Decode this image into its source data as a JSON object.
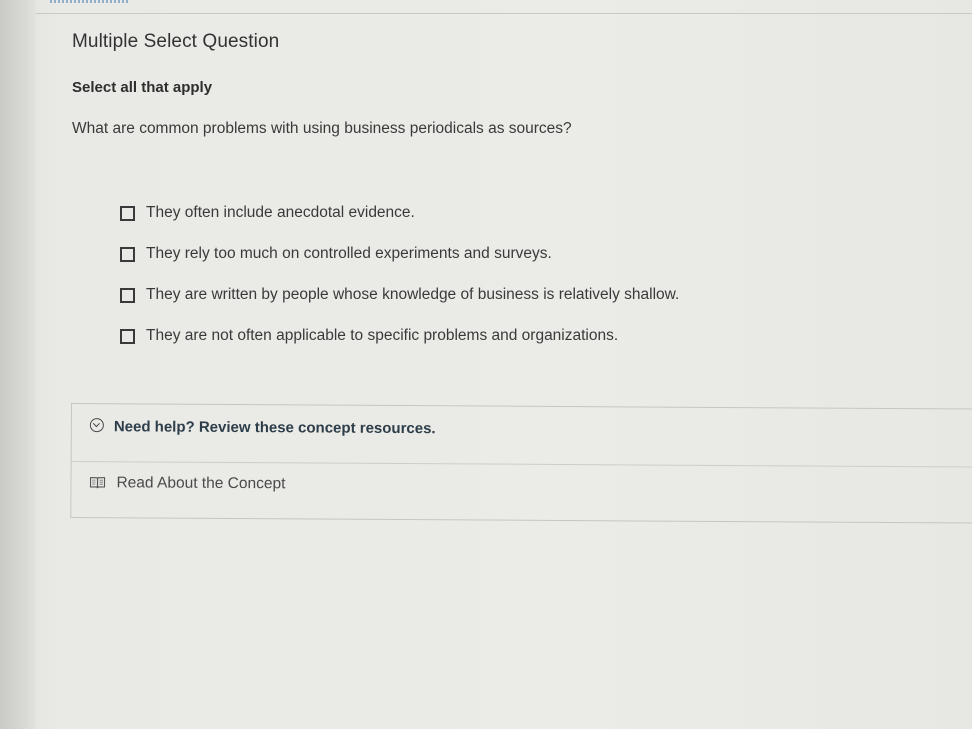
{
  "question": {
    "type_label": "Multiple Select Question",
    "instruction": "Select all that apply",
    "prompt": "What are common problems with using business periodicals as sources?",
    "options": [
      {
        "label": "They often include anecdotal evidence.",
        "checked": false
      },
      {
        "label": "They rely too much on controlled experiments and surveys.",
        "checked": false
      },
      {
        "label": "They are written by people whose knowledge of business is relatively shallow.",
        "checked": false
      },
      {
        "label": "They are not often applicable to specific problems and organizations.",
        "checked": false
      }
    ]
  },
  "help": {
    "title": "Need help? Review these concept resources.",
    "toggle_icon": "chevron-circle-down-icon",
    "resources": [
      {
        "label": "Read About the Concept",
        "icon": "book-icon"
      }
    ]
  }
}
